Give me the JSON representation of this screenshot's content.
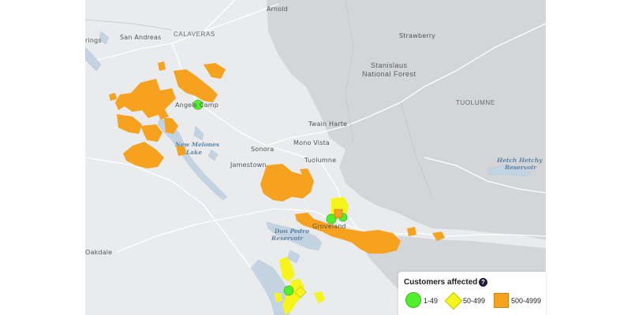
{
  "map": {
    "place_labels": {
      "arnold": "Arnold",
      "calaveras": "CALAVERAS",
      "san_andreas": "San Andreas",
      "rings_partial": "rings",
      "strawberry": "Strawberry",
      "stanislaus_line1": "Stanislaus",
      "stanislaus_line2": "National Forest",
      "tuolumne_county": "TUOLUMNE",
      "angels_camp": "Angels Camp",
      "twain_harte": "Twain Harte",
      "mono_vista": "Mono Vista",
      "sonora": "Sonora",
      "jamestown": "Jamestown",
      "tuolumne_town": "Tuolumne",
      "groveland": "Groveland",
      "oakdale": "Oakdale"
    },
    "water_labels": {
      "new_melones_1": "New Melones",
      "new_melones_2": "Lake",
      "hetch_hetchy_1": "Hetch Hetchy",
      "hetch_hetchy_2": "Reservoir",
      "don_pedro_1": "Don Pedro",
      "don_pedro_2": "Reservoir"
    }
  },
  "legend": {
    "title": "Customers affected",
    "help_icon": "?",
    "items": [
      {
        "label": "1-49",
        "symbol": "circle",
        "color": "#52ef2c"
      },
      {
        "label": "50-499",
        "symbol": "diamond",
        "color": "#f5f51c"
      },
      {
        "label": "500-4999",
        "symbol": "square",
        "color": "#f7a21e"
      }
    ]
  },
  "colors": {
    "land": "#e9ebed",
    "forest": "#d3d5d8",
    "water": "#c3d3e2",
    "outage_orange": "#f7a21e",
    "outage_yellow": "#f5f51c",
    "outage_green": "#52ef2c"
  }
}
